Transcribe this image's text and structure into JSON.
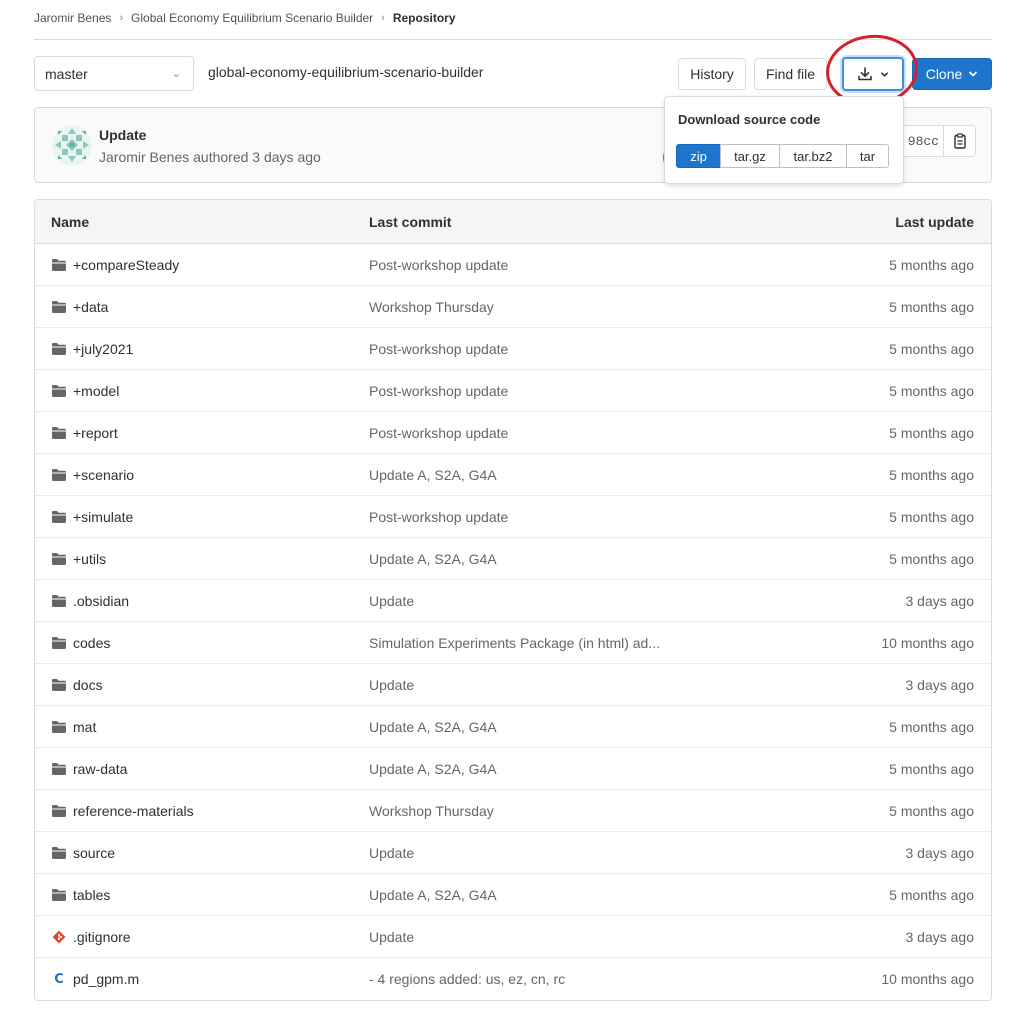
{
  "breadcrumb": [
    {
      "label": "Jaromir Benes"
    },
    {
      "label": "Global Economy Equilibrium Scenario Builder"
    },
    {
      "label": "Repository"
    }
  ],
  "toolbar": {
    "branch": "master",
    "repo_path": "global-economy-equilibrium-scenario-builder",
    "history_label": "History",
    "find_file_label": "Find file",
    "clone_label": "Clone",
    "download_icon": "download-icon"
  },
  "download_menu": {
    "title": "Download source code",
    "formats": [
      {
        "label": "zip",
        "active": true
      },
      {
        "label": "tar.gz",
        "active": false
      },
      {
        "label": "tar.bz2",
        "active": false
      },
      {
        "label": "tar",
        "active": false
      }
    ]
  },
  "last_commit": {
    "title": "Update",
    "author": "Jaromir Benes authored 3 days ago",
    "sha_fragment": "98cc"
  },
  "tree": {
    "headers": {
      "name": "Name",
      "commit": "Last commit",
      "update": "Last update"
    },
    "rows": [
      {
        "name": "+compareSteady",
        "icon": "folder-icon",
        "commit": "Post-workshop update",
        "updated": "5 months ago"
      },
      {
        "name": "+data",
        "icon": "folder-icon",
        "commit": "Workshop Thursday",
        "updated": "5 months ago"
      },
      {
        "name": "+july2021",
        "icon": "folder-icon",
        "commit": "Post-workshop update",
        "updated": "5 months ago"
      },
      {
        "name": "+model",
        "icon": "folder-icon",
        "commit": "Post-workshop update",
        "updated": "5 months ago"
      },
      {
        "name": "+report",
        "icon": "folder-icon",
        "commit": "Post-workshop update",
        "updated": "5 months ago"
      },
      {
        "name": "+scenario",
        "icon": "folder-icon",
        "commit": "Update A, S2A, G4A",
        "updated": "5 months ago"
      },
      {
        "name": "+simulate",
        "icon": "folder-icon",
        "commit": "Post-workshop update",
        "updated": "5 months ago"
      },
      {
        "name": "+utils",
        "icon": "folder-icon",
        "commit": "Update A, S2A, G4A",
        "updated": "5 months ago"
      },
      {
        "name": ".obsidian",
        "icon": "folder-icon",
        "commit": "Update",
        "updated": "3 days ago"
      },
      {
        "name": "codes",
        "icon": "folder-icon",
        "commit": "Simulation Experiments Package (in html) ad...",
        "updated": "10 months ago"
      },
      {
        "name": "docs",
        "icon": "folder-icon",
        "commit": "Update",
        "updated": "3 days ago"
      },
      {
        "name": "mat",
        "icon": "folder-icon",
        "commit": "Update A, S2A, G4A",
        "updated": "5 months ago"
      },
      {
        "name": "raw-data",
        "icon": "folder-icon",
        "commit": "Update A, S2A, G4A",
        "updated": "5 months ago"
      },
      {
        "name": "reference-materials",
        "icon": "folder-icon",
        "commit": "Workshop Thursday",
        "updated": "5 months ago"
      },
      {
        "name": "source",
        "icon": "folder-icon",
        "commit": "Update",
        "updated": "3 days ago"
      },
      {
        "name": "tables",
        "icon": "folder-icon",
        "commit": "Update A, S2A, G4A",
        "updated": "5 months ago"
      },
      {
        "name": ".gitignore",
        "icon": "git-icon",
        "commit": "Update",
        "updated": "3 days ago"
      },
      {
        "name": "pd_gpm.m",
        "icon": "matlab-file-icon",
        "commit": "- 4 regions added: us, ez, cn, rc",
        "updated": "10 months ago"
      }
    ]
  },
  "colors": {
    "primary": "#1f75cb",
    "annotation_red": "#d6202b",
    "folder_gray": "#666666",
    "git_orange": "#e24329"
  }
}
